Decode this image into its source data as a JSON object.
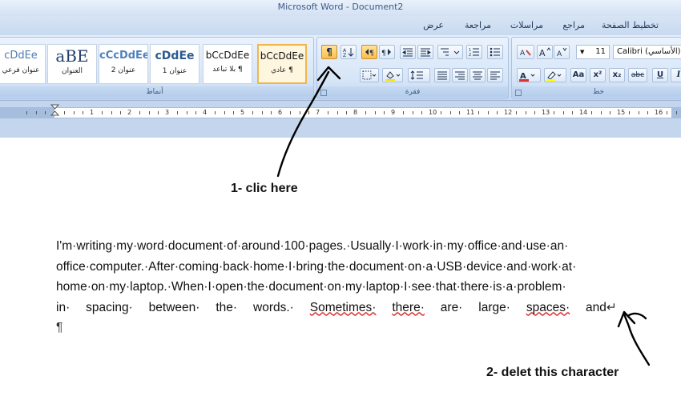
{
  "window": {
    "title": "Microsoft Word - Document2"
  },
  "tabs": [
    {
      "label": "تخطيط الصفحة"
    },
    {
      "label": "مراجع"
    },
    {
      "label": "مراسلات"
    },
    {
      "label": "مراجعة"
    },
    {
      "label": "عرض"
    }
  ],
  "styles_group": {
    "label": "أنماط",
    "items": [
      {
        "sample": "cDdEe",
        "name": "عنوان فرعي"
      },
      {
        "sample": "aBE",
        "name": "العنوان"
      },
      {
        "sample": "cCcDdEe",
        "name": "عنوان 2"
      },
      {
        "sample": "cDdEe",
        "name": "عنوان 1"
      },
      {
        "sample": "bCcDdEe",
        "name": "¶ بلا تباعد"
      },
      {
        "sample": "bCcDdEe",
        "name": "¶ عادي"
      }
    ]
  },
  "paragraph_group": {
    "label": "فقرة",
    "pilcrow": "¶"
  },
  "font_group": {
    "label": "خط",
    "font_name": "Calibri (الأساسي)",
    "font_size": "11"
  },
  "ruler": {
    "numbers": [
      "1",
      "2",
      "3",
      "4",
      "5",
      "6",
      "7",
      "8",
      "9",
      "10",
      "11",
      "12",
      "13",
      "14",
      "15",
      "16"
    ]
  },
  "document": {
    "lines": [
      "I'm·writing·my·word·document·of·around·100·pages.·Usually·I·work·in·my·office·and·use·an·",
      "office·computer.·After·coming·back·home·I·bring·the·document·on·a·USB·device·and·work·at·",
      "home·on·my·laptop.·When·I·open·the·document·on·my·laptop·I·see·that·there·is·a·problem·"
    ],
    "last_line_words": [
      "in·",
      "spacing·",
      "between·",
      "the·",
      "words.·",
      "Sometimes·",
      "there·",
      "are·",
      "large·",
      "spaces·",
      "and"
    ],
    "line_break_mark": "↵",
    "paragraph_mark": "¶"
  },
  "annotations": {
    "step1": "1- clic here",
    "step2": "2- delet this character"
  }
}
